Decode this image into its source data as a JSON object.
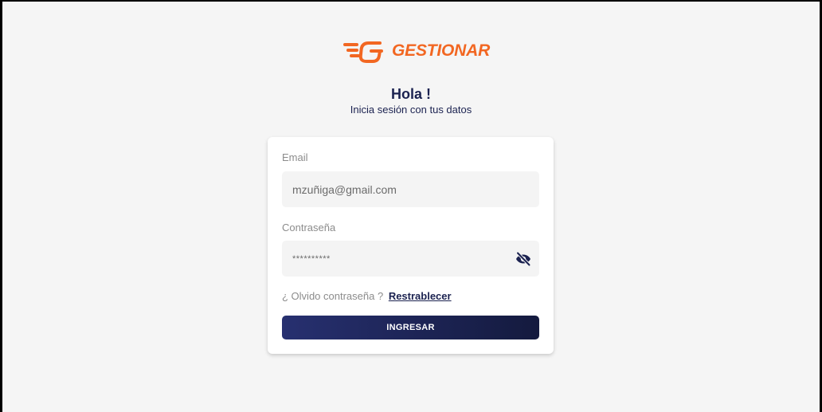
{
  "colors": {
    "page_background": "#f5f5f5",
    "brand_orange": "#f26722",
    "navy": "#1b2250",
    "button_gradient_start": "#273070",
    "button_gradient_end": "#141a3e",
    "label_gray": "#8c8c8c",
    "input_background": "#f4f4f4",
    "input_text": "#6b6b6b"
  },
  "brand": {
    "name": "GESTIONAR",
    "icon": "winged-g-logo-icon"
  },
  "header": {
    "greeting": "Hola !",
    "subtitle": "Inicia sesión con tus datos"
  },
  "form": {
    "email_label": "Email",
    "email_value": "mzuñiga@gmail.com",
    "password_label": "Contraseña",
    "password_value": "**********",
    "password_toggle_icon": "eye-slash-icon",
    "forgot_prompt": "¿ Olvido contraseña ?",
    "reset_link": "Restrablecer",
    "submit_label": "INGRESAR"
  }
}
